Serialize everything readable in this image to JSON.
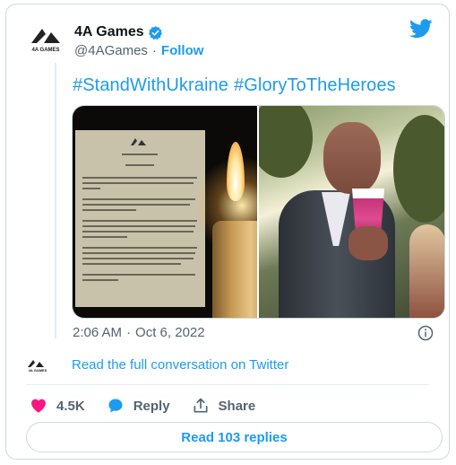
{
  "author": {
    "name": "4A Games",
    "handle": "@4AGames",
    "follow_label": "Follow",
    "avatar_text": "4A GAMES"
  },
  "tweet": {
    "hashtags": [
      "#StandWithUkraine",
      "#GloryToTheHeroes"
    ]
  },
  "media": {
    "left_image": "memorial-note-with-candle",
    "right_image": "man-holding-cup"
  },
  "meta": {
    "time": "2:06 AM",
    "separator": "·",
    "date": "Oct 6, 2022"
  },
  "conversation": {
    "link_text": "Read the full conversation on Twitter"
  },
  "actions": {
    "likes": "4.5K",
    "reply_label": "Reply",
    "share_label": "Share"
  },
  "footer": {
    "read_replies": "Read 103 replies"
  },
  "colors": {
    "accent": "#1d9bf0",
    "heart": "#f91880",
    "muted": "#536471",
    "border": "#cfd9de"
  }
}
